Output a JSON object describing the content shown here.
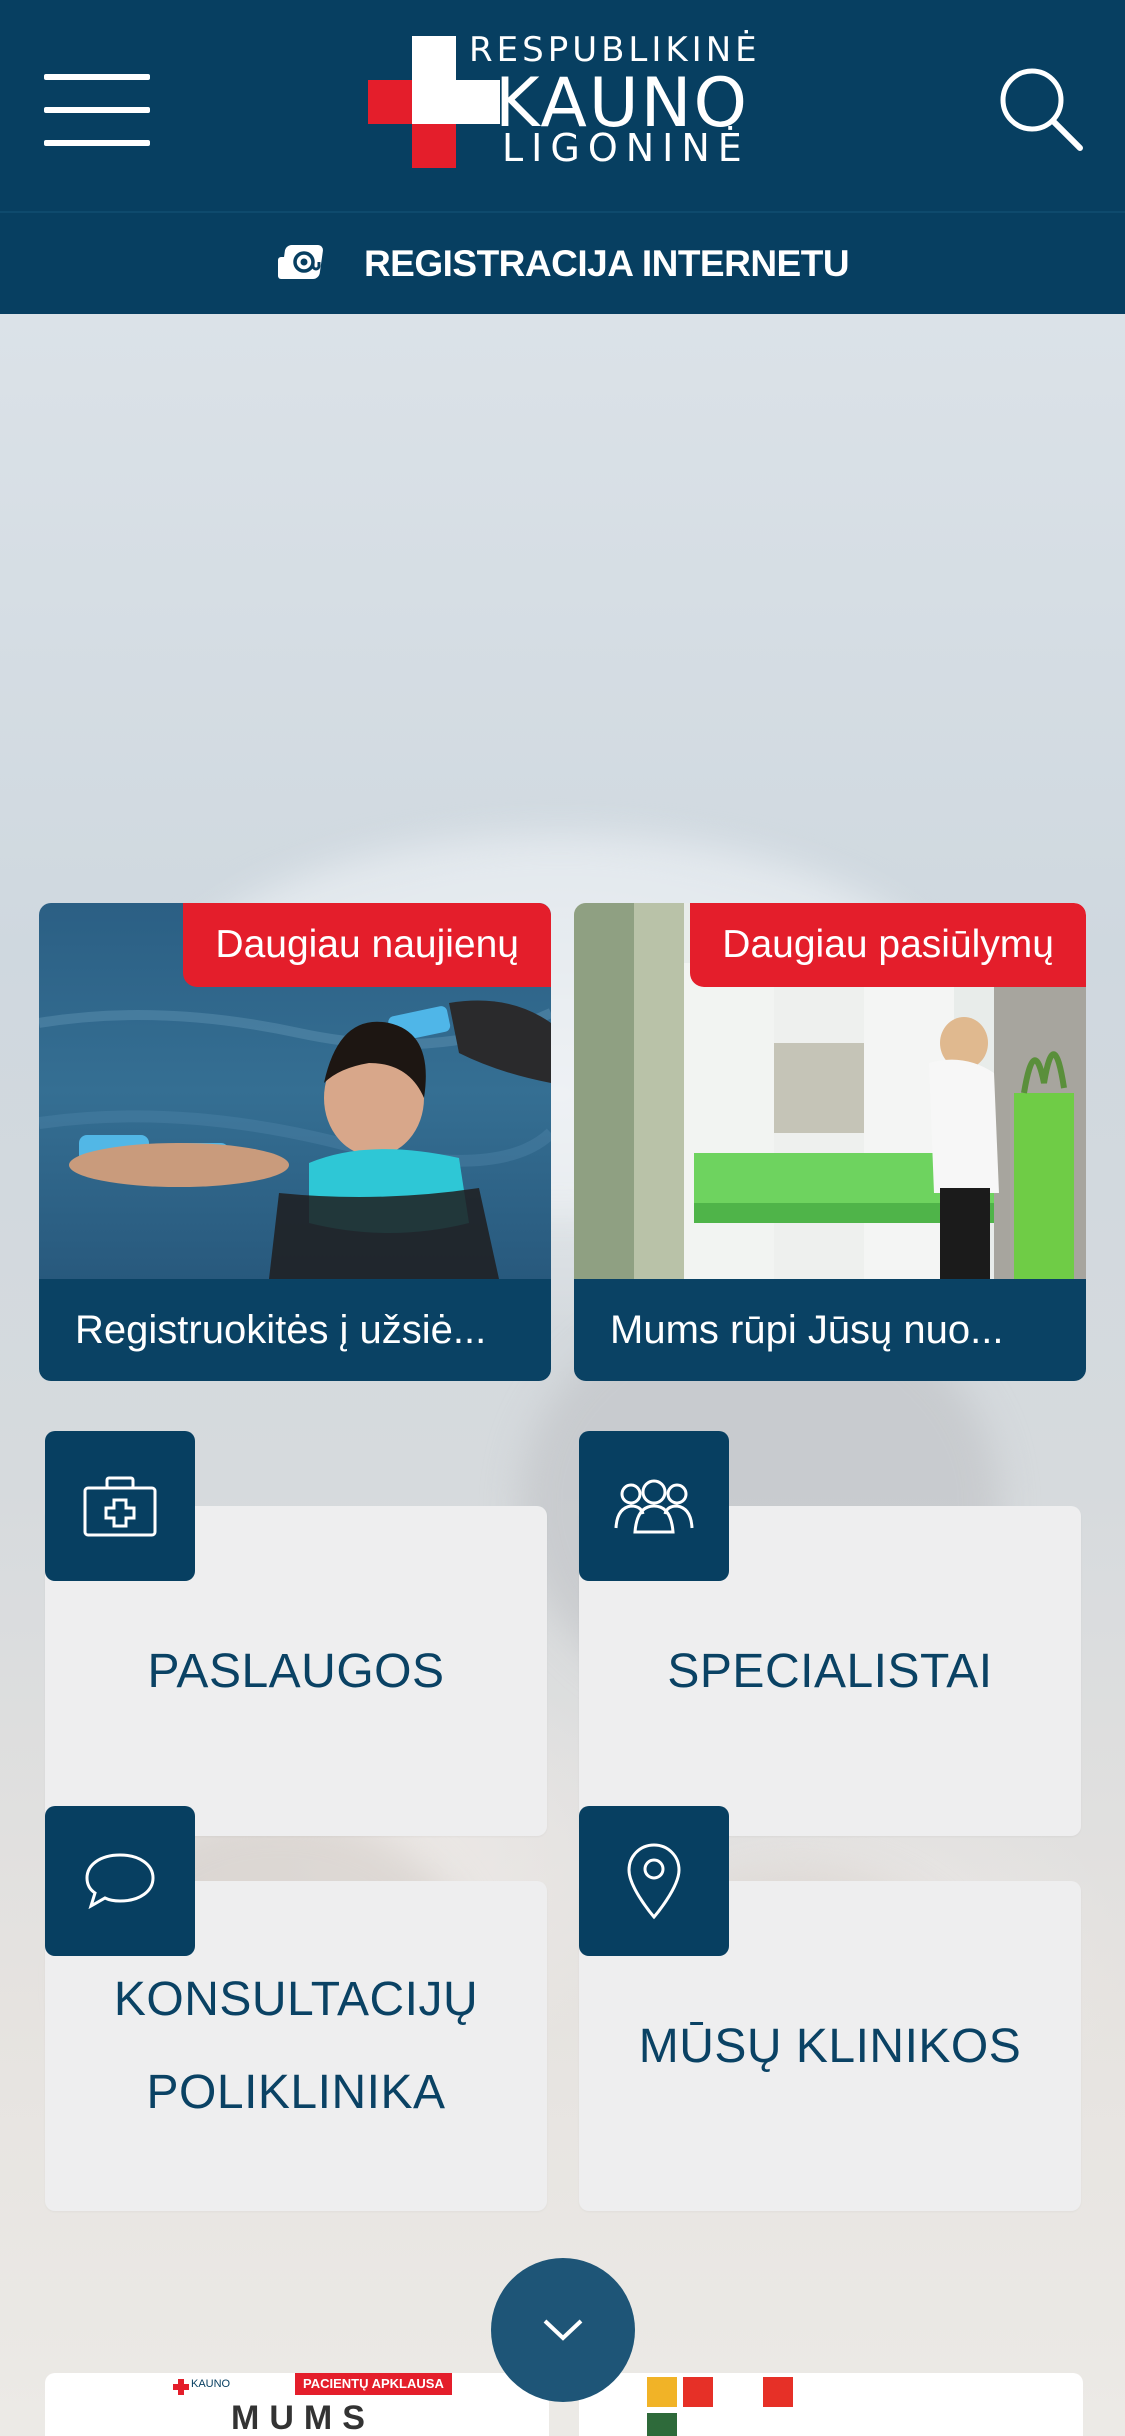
{
  "header": {
    "logo_line1": "RESPUBLIKINĖ",
    "logo_line2": "KAUNO",
    "logo_line3": "LIGONINĖ",
    "menu_icon": "hamburger-menu-icon",
    "search_icon": "search-icon"
  },
  "registration": {
    "label": "REGISTRACIJA INTERNETU",
    "icon": "at-sign-icon"
  },
  "news": [
    {
      "badge": "Daugiau naujienų",
      "caption": "Registruokitės į užsiė..."
    },
    {
      "badge": "Daugiau pasiūlymų",
      "caption": "Mums rūpi Jūsų nuo..."
    }
  ],
  "tiles": [
    {
      "label": "PASLAUGOS",
      "icon": "first-aid-kit-icon"
    },
    {
      "label": "SPECIALISTAI",
      "icon": "people-icon"
    },
    {
      "label_line1": "KONSULTACIJŲ",
      "label_line2": "POLIKLINIKA",
      "icon": "speech-bubble-icon"
    },
    {
      "label": "MŪSŲ KLINIKOS",
      "icon": "location-pin-icon"
    }
  ],
  "scroll_button_icon": "chevron-down-icon",
  "bottom_cards": {
    "left_badge": "PACIENTŲ APKLAUSA",
    "left_logo_text": "KAUNO",
    "left_title": "MUMS"
  },
  "colors": {
    "primary": "#073f61",
    "accent_red": "#e41e2b",
    "tile_bg": "#eeeeef",
    "tile_text": "#0a4264"
  }
}
